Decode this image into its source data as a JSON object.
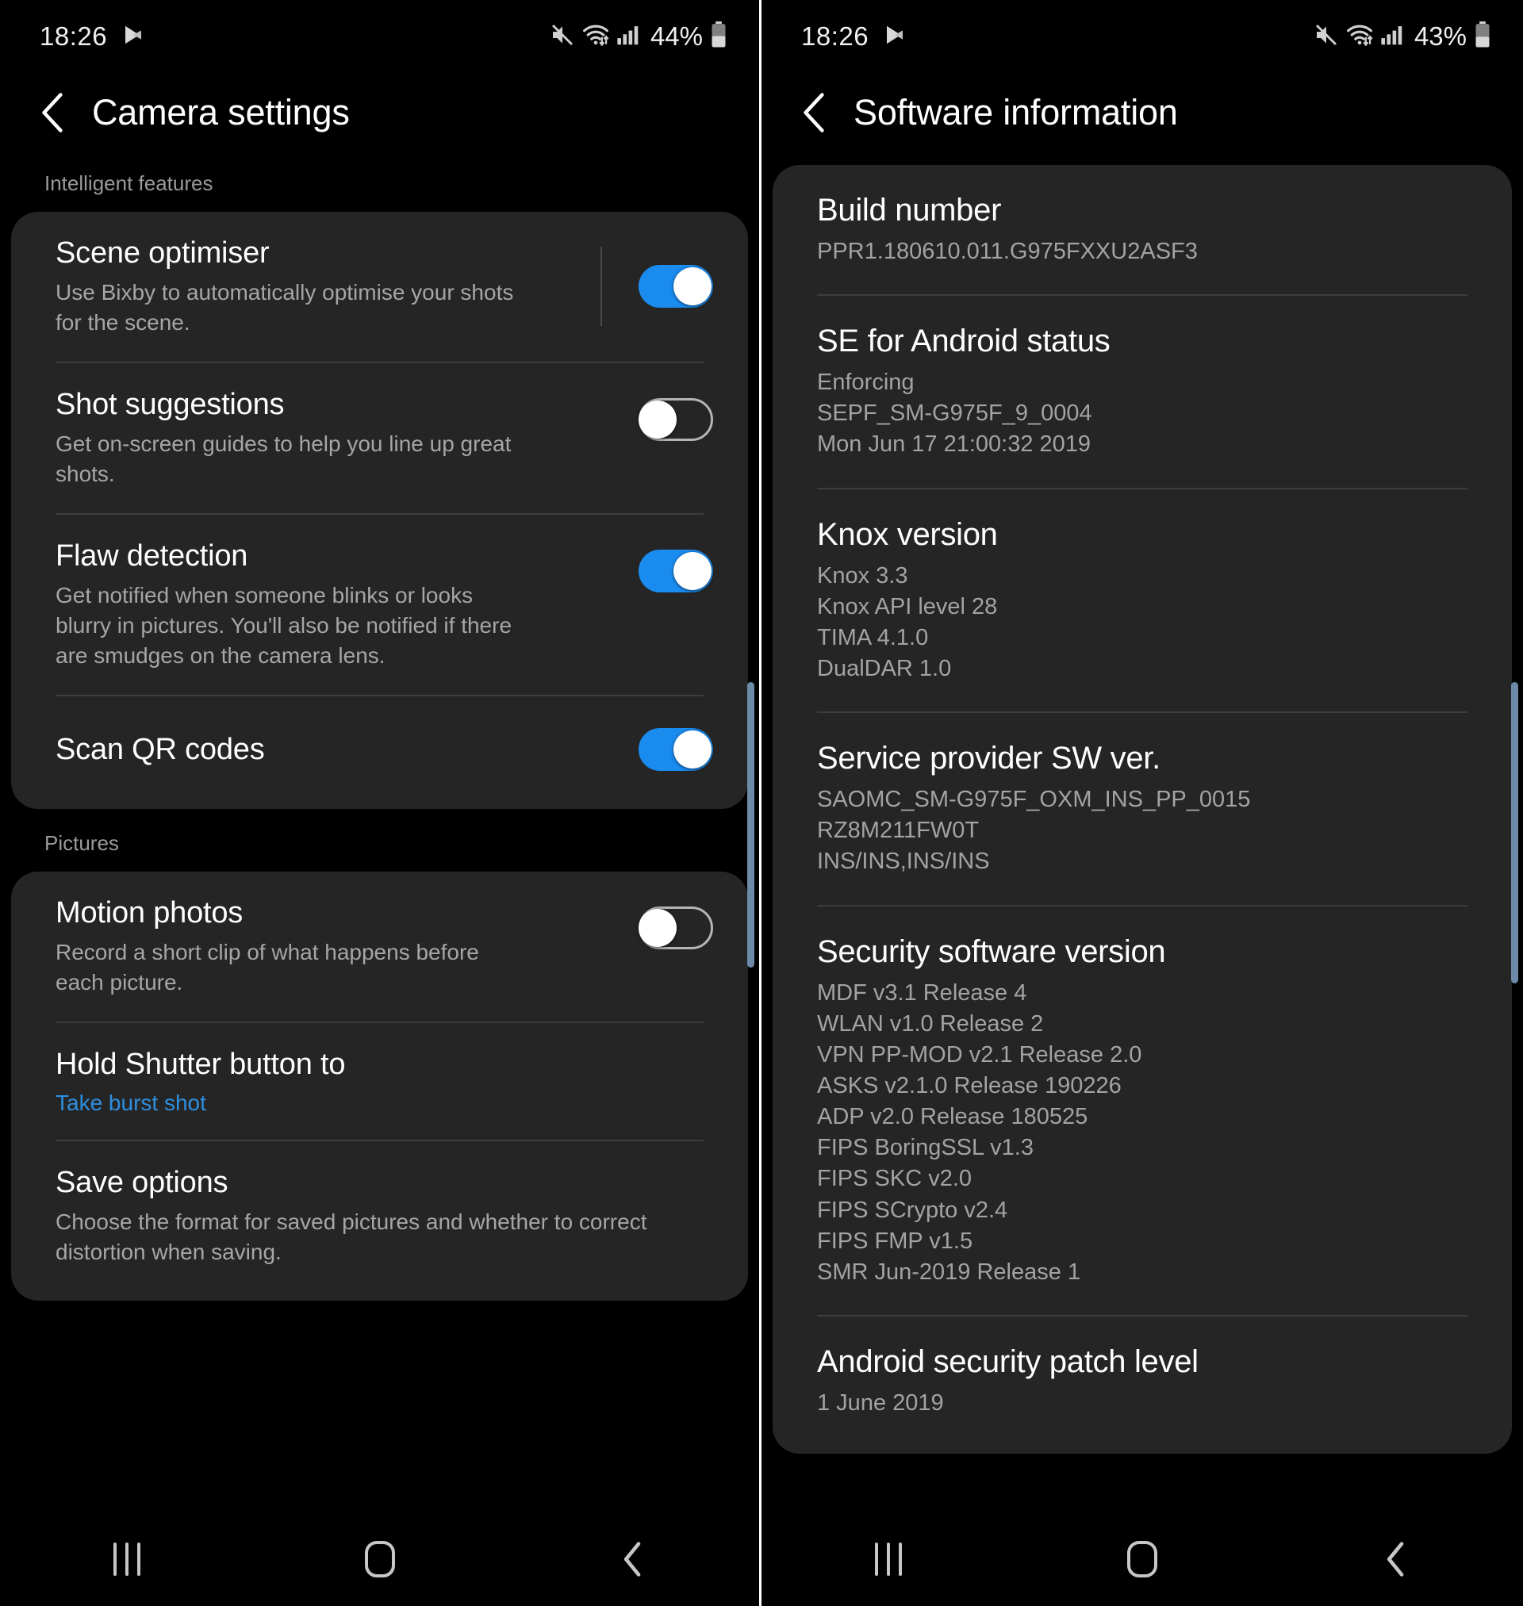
{
  "panels": [
    {
      "id": "camera-settings",
      "statusbar": {
        "time": "18:26",
        "play_icon": "play-store-icon",
        "mute_icon": "mute-icon",
        "wifi_icon": "wifi-icon",
        "signal_icon": "cellular-signal-icon",
        "battery_pct": "44%",
        "battery_icon": "battery-icon"
      },
      "title": "Camera settings",
      "back_icon": "back-chevron-icon",
      "sections": [
        {
          "label": "Intelligent features",
          "items": [
            {
              "title": "Scene optimiser",
              "desc": "Use Bixby to automatically optimise your shots for the scene.",
              "toggle": "on",
              "has_separator": true
            },
            {
              "title": "Shot suggestions",
              "desc": "Get on-screen guides to help you line up great shots.",
              "toggle": "off",
              "has_separator": false
            },
            {
              "title": "Flaw detection",
              "desc": "Get notified when someone blinks or looks blurry in pictures. You'll also be notified if there are smudges on the camera lens.",
              "toggle": "on",
              "has_separator": false
            },
            {
              "title": "Scan QR codes",
              "desc": "",
              "toggle": "on",
              "has_separator": false
            }
          ]
        },
        {
          "label": "Pictures",
          "items": [
            {
              "title": "Motion photos",
              "desc": "Record a short clip of what happens before each picture.",
              "toggle": "off",
              "has_separator": false
            },
            {
              "title": "Hold Shutter button to",
              "value": "Take burst shot",
              "toggle": "none",
              "has_separator": false
            },
            {
              "title": "Save options",
              "desc": "Choose the format for saved pictures and whether to correct distortion when saving.",
              "toggle": "none",
              "has_separator": false
            }
          ]
        }
      ]
    },
    {
      "id": "software-information",
      "statusbar": {
        "time": "18:26",
        "play_icon": "play-store-icon",
        "mute_icon": "mute-icon",
        "wifi_icon": "wifi-icon",
        "signal_icon": "cellular-signal-icon",
        "battery_pct": "43%",
        "battery_icon": "battery-icon"
      },
      "title": "Software information",
      "back_icon": "back-chevron-icon",
      "items": [
        {
          "title": "Build number",
          "lines": [
            "PPR1.180610.011.G975FXXU2ASF3"
          ]
        },
        {
          "title": "SE for Android status",
          "lines": [
            "Enforcing",
            "SEPF_SM-G975F_9_0004",
            "Mon Jun 17 21:00:32 2019"
          ]
        },
        {
          "title": "Knox version",
          "lines": [
            "Knox 3.3",
            "Knox API level 28",
            "TIMA 4.1.0",
            "DualDAR 1.0"
          ]
        },
        {
          "title": "Service provider SW ver.",
          "lines": [
            "SAOMC_SM-G975F_OXM_INS_PP_0015",
            "RZ8M211FW0T",
            "INS/INS,INS/INS"
          ]
        },
        {
          "title": "Security software version",
          "lines": [
            "MDF v3.1 Release 4",
            "WLAN v1.0 Release 2",
            "VPN PP-MOD v2.1 Release 2.0",
            "ASKS v2.1.0 Release 190226",
            "ADP v2.0 Release 180525",
            "FIPS BoringSSL v1.3",
            "FIPS SKC v2.0",
            "FIPS SCrypto v2.4",
            "FIPS FMP v1.5",
            "SMR Jun-2019 Release 1"
          ]
        },
        {
          "title": "Android security patch level",
          "lines": [
            "1 June 2019"
          ]
        }
      ]
    }
  ],
  "navbar": {
    "recents_icon": "recents-icon",
    "home_icon": "home-icon",
    "back_icon": "back-icon"
  },
  "colors": {
    "accent_blue": "#1a8cf0",
    "link_blue": "#2e8fe0",
    "card_bg": "#252525",
    "page_bg": "#000000",
    "scrollbar": "#6d8aa8"
  }
}
